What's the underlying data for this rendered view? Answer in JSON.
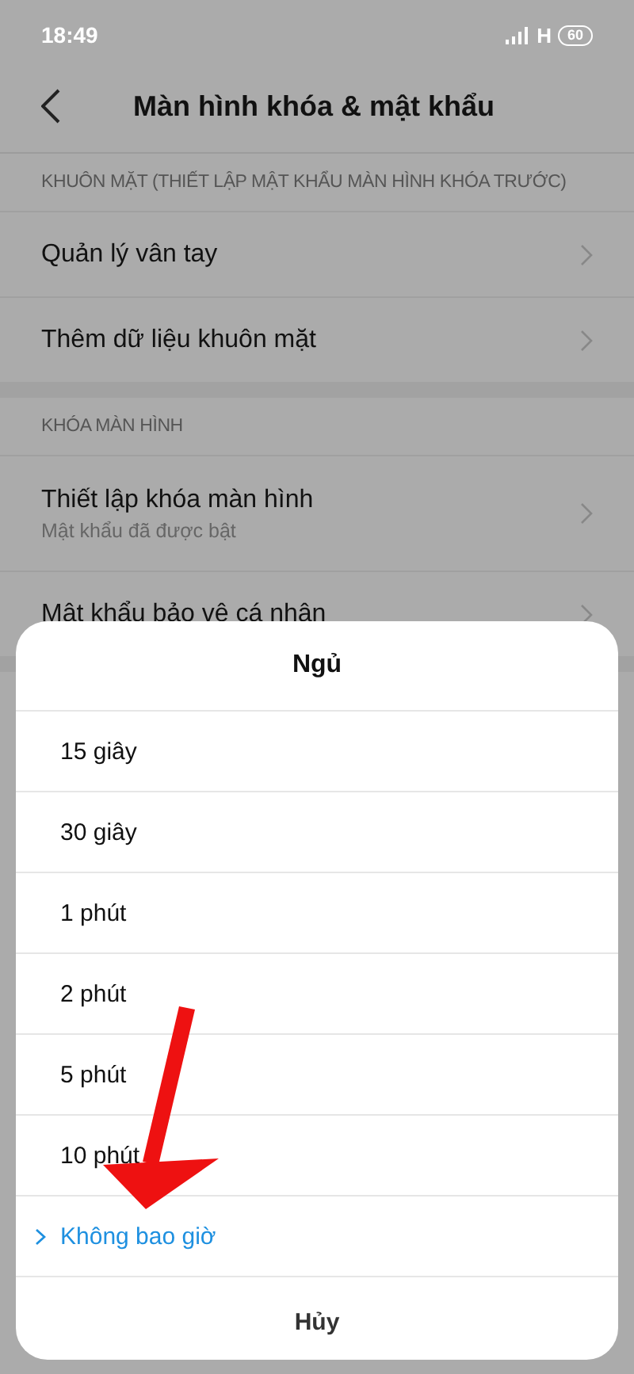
{
  "status_bar": {
    "time": "18:49",
    "network": "H",
    "battery": "60"
  },
  "header": {
    "title": "Màn hình khóa & mật khẩu"
  },
  "sections": [
    {
      "header": "KHUÔN MẶT (THIẾT LẬP MẬT KHẨU MÀN HÌNH KHÓA TRƯỚC)",
      "items": [
        {
          "title": "Quản lý vân tay"
        },
        {
          "title": "Thêm dữ liệu khuôn mặt"
        }
      ]
    },
    {
      "header": "KHÓA MÀN HÌNH",
      "items": [
        {
          "title": "Thiết lập khóa màn hình",
          "subtitle": "Mật khẩu đã được bật"
        },
        {
          "title": "Mật khẩu bảo vệ cá nhân"
        }
      ]
    }
  ],
  "dialog": {
    "title": "Ngủ",
    "options": [
      {
        "label": "15 giây",
        "selected": false
      },
      {
        "label": "30 giây",
        "selected": false
      },
      {
        "label": "1 phút",
        "selected": false
      },
      {
        "label": "2 phút",
        "selected": false
      },
      {
        "label": "5 phút",
        "selected": false
      },
      {
        "label": "10 phút",
        "selected": false
      },
      {
        "label": "Không bao giờ",
        "selected": true
      }
    ],
    "cancel": "Hủy"
  }
}
